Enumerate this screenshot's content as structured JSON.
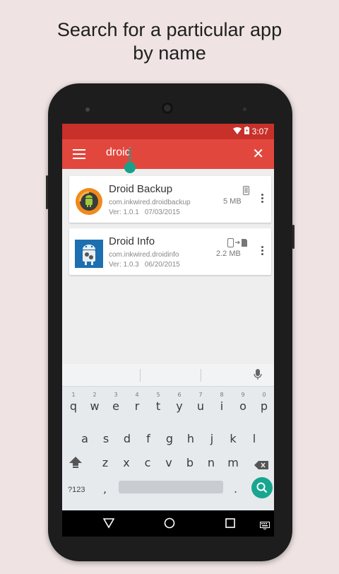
{
  "headline": {
    "line1": "Search for a particular app",
    "line2": "by name"
  },
  "status_bar": {
    "time": "3:07"
  },
  "search": {
    "query": "droid"
  },
  "apps": [
    {
      "name": "Droid Backup",
      "package": "com.inkwired.droidbackup",
      "version": "Ver: 1.0.1",
      "date": "07/03/2015",
      "size": "5 MB",
      "location_icon": "phone-icon"
    },
    {
      "name": "Droid Info",
      "package": "com.inkwired.droidinfo",
      "version": "Ver: 1.0.3",
      "date": "06/20/2015",
      "size": "2.2 MB",
      "location_icon": "phone-to-sd-icon"
    }
  ],
  "keyboard": {
    "row1": [
      "q",
      "w",
      "e",
      "r",
      "t",
      "y",
      "u",
      "i",
      "o",
      "p"
    ],
    "row1_numbers": [
      "1",
      "2",
      "3",
      "4",
      "5",
      "6",
      "7",
      "8",
      "9",
      "0"
    ],
    "row2": [
      "a",
      "s",
      "d",
      "f",
      "g",
      "h",
      "j",
      "k",
      "l"
    ],
    "row3": [
      "z",
      "x",
      "c",
      "v",
      "b",
      "n",
      "m"
    ],
    "symbols_key": "?123",
    "comma": ",",
    "period": "."
  },
  "colors": {
    "toolbar": "#e2473e",
    "statusbar": "#c8302a",
    "accent": "#18a690",
    "background": "#efe3e3"
  }
}
